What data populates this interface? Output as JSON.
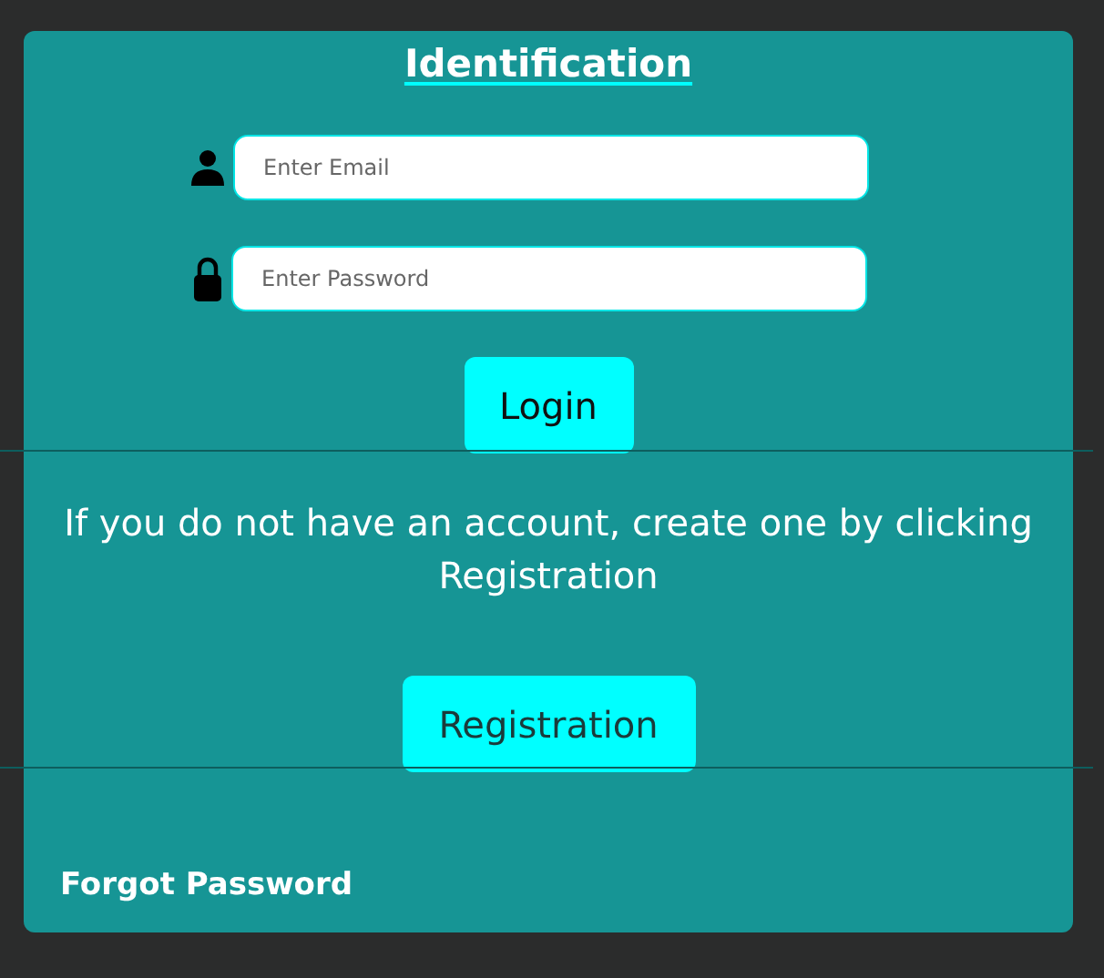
{
  "title": "Identification",
  "fields": [
    {
      "kind": "email",
      "placeholder": "Enter Email"
    },
    {
      "kind": "password",
      "placeholder": "Enter Password"
    }
  ],
  "login_button": "Login",
  "message": "If you do not have an account, create one by clicking Registration",
  "registration_button": "Registration",
  "forgot_password": "Forgot Password"
}
